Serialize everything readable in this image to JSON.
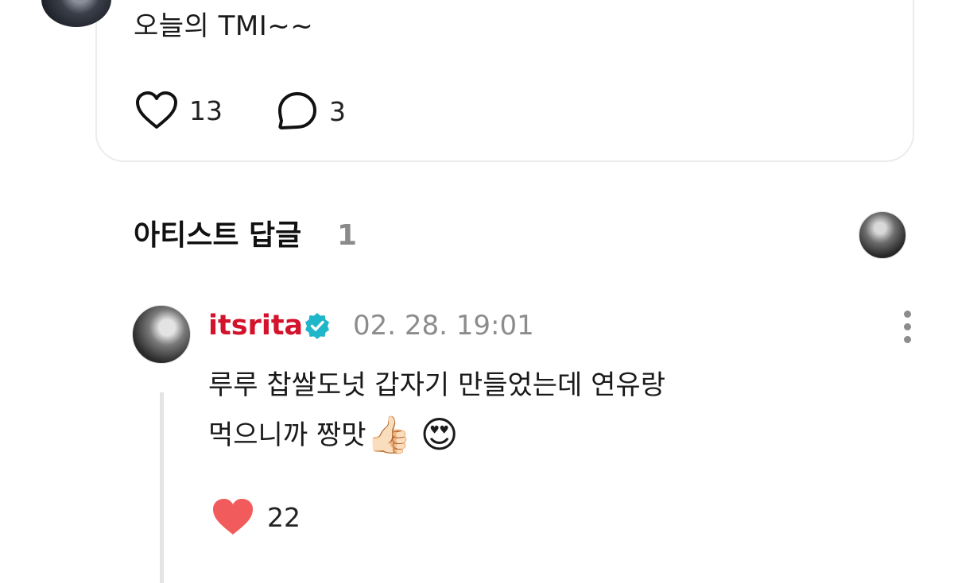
{
  "post": {
    "text": "오늘의 TMI~~",
    "likes": "13",
    "comments": "3"
  },
  "artist_replies": {
    "title": "아티스트 답글",
    "count": "1"
  },
  "reply": {
    "username": "itsrita",
    "timestamp": "02. 28. 19:01",
    "line1": "루루 찹쌀도넛 갑자기 만들었는데 연유랑",
    "line2": "먹으니까 짱맛",
    "emoji_thumbs": "👍🏻",
    "emoji_heart_eyes": "😍",
    "likes": "22"
  },
  "colors": {
    "username": "#d3122b",
    "verified_badge": "#1fb6c9",
    "liked_heart": "#f15b5b",
    "muted_text": "#8c8c8c"
  },
  "icons": [
    "heart-outline-icon",
    "comment-bubble-icon",
    "verified-badge-icon",
    "more-vertical-icon",
    "heart-filled-icon"
  ]
}
